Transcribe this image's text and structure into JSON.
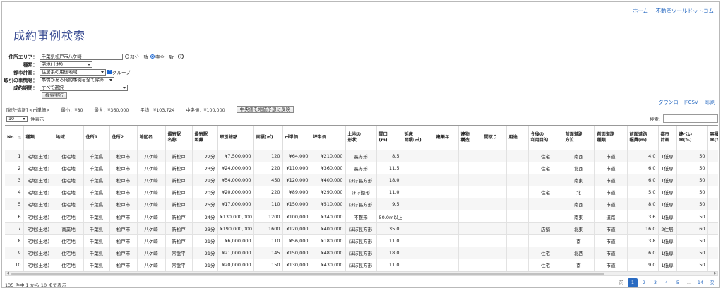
{
  "nav": {
    "home": "ホーム",
    "site": "不動産ツールドットコム"
  },
  "page_title": "成約事例検索",
  "form": {
    "area": {
      "label": "住所エリア：",
      "value": "千葉県松戸市八ケ崎",
      "opt_partial": "部分一致",
      "opt_exact": "完全一致"
    },
    "kind": {
      "label": "種類：",
      "value": "宅地(土地)"
    },
    "city_plan": {
      "label": "都市計画：",
      "value": "住居系の用途地域",
      "group": "グループ"
    },
    "circumstance": {
      "label": "取引の事情等：",
      "value": "事情がある成約事例を全て除外"
    },
    "period": {
      "label": "成約期間：",
      "value": "すべて選択"
    },
    "submit": "検索実行"
  },
  "stats": {
    "label": "[統計情報] <㎡単価>",
    "min": "最小：¥80",
    "max": "最大：¥360,000",
    "avg": "平均：¥103,724",
    "median": "中央値：¥100,000",
    "reflect_button": "中央値を地価予想に反映"
  },
  "links": {
    "csv": "ダウンロードCSV",
    "print": "印刷"
  },
  "length": {
    "value": "10",
    "suffix": "件表示"
  },
  "search_label": "検索:",
  "columns": [
    "No",
    "種類",
    "地域",
    "住所1",
    "住所2",
    "地区名",
    "最寄駅\n名称",
    "最寄駅\n距離",
    "取引総額",
    "面積(㎡)",
    "㎡単価",
    "坪単価",
    "土地の\n形状",
    "間口\n(m)",
    "延床\n面積(㎡)",
    "建築年",
    "建物\n構造",
    "間取り",
    "用途",
    "今後の\n利用目的",
    "前面道路\n方位",
    "前面道路\n種類",
    "前面道路\n幅員(m)",
    "都市\n計画",
    "建ぺい\n率(%)",
    "容積\n率(%)"
  ],
  "rows": [
    [
      "1",
      "宅地(土地)",
      "住宅地",
      "千葉県",
      "松戸市",
      "八ケ崎",
      "新松戸",
      "22分",
      "¥7,500,000",
      "120",
      "¥64,000",
      "¥210,000",
      "長方形",
      "8.5",
      "",
      "",
      "",
      "",
      "",
      "住宅",
      "南西",
      "市道",
      "4.0",
      "1低専",
      "50",
      ""
    ],
    [
      "2",
      "宅地(土地)",
      "住宅地",
      "千葉県",
      "松戸市",
      "八ケ崎",
      "新松戸",
      "23分",
      "¥24,000,000",
      "220",
      "¥110,000",
      "¥360,000",
      "長方形",
      "11.5",
      "",
      "",
      "",
      "",
      "",
      "住宅",
      "北西",
      "市道",
      "6.0",
      "1低専",
      "50",
      ""
    ],
    [
      "3",
      "宅地(土地)",
      "住宅地",
      "千葉県",
      "松戸市",
      "八ケ崎",
      "新松戸",
      "29分",
      "¥54,000,000",
      "450",
      "¥120,000",
      "¥400,000",
      "ほぼ長方形",
      "18.0",
      "",
      "",
      "",
      "",
      "",
      "",
      "南東",
      "市道",
      "6.0",
      "1低専",
      "50",
      ""
    ],
    [
      "4",
      "宅地(土地)",
      "住宅地",
      "千葉県",
      "松戸市",
      "八ケ崎",
      "新松戸",
      "20分",
      "¥20,000,000",
      "220",
      "¥89,000",
      "¥290,000",
      "ほぼ整形",
      "11.0",
      "",
      "",
      "",
      "",
      "",
      "住宅",
      "北",
      "市道",
      "5.0",
      "1低専",
      "50",
      ""
    ],
    [
      "5",
      "宅地(土地)",
      "住宅地",
      "千葉県",
      "松戸市",
      "八ケ崎",
      "新松戸",
      "25分",
      "¥17,000,000",
      "110",
      "¥150,000",
      "¥510,000",
      "ほぼ長方形",
      "9.5",
      "",
      "",
      "",
      "",
      "",
      "",
      "南西",
      "市道",
      "8.0",
      "1低専",
      "50",
      ""
    ],
    [
      "6",
      "宅地(土地)",
      "住宅地",
      "千葉県",
      "松戸市",
      "八ケ崎",
      "新松戸",
      "24分",
      "¥130,000,000",
      "1200",
      "¥100,000",
      "¥340,000",
      "不整形",
      "50.0m以上",
      "",
      "",
      "",
      "",
      "",
      "",
      "南東",
      "道路",
      "3.6",
      "1低専",
      "50",
      ""
    ],
    [
      "7",
      "宅地(土地)",
      "商業地",
      "千葉県",
      "松戸市",
      "八ケ崎",
      "新松戸",
      "23分",
      "¥190,000,000",
      "1600",
      "¥120,000",
      "¥400,000",
      "ほぼ長方形",
      "35.0",
      "",
      "",
      "",
      "",
      "",
      "店舗",
      "北東",
      "市道",
      "16.0",
      "2住居",
      "60",
      ""
    ],
    [
      "8",
      "宅地(土地)",
      "住宅地",
      "千葉県",
      "松戸市",
      "八ケ崎",
      "新松戸",
      "21分",
      "¥6,000,000",
      "110",
      "¥56,000",
      "¥180,000",
      "ほぼ長方形",
      "11.0",
      "",
      "",
      "",
      "",
      "",
      "",
      "南",
      "市道",
      "3.8",
      "1低専",
      "50",
      ""
    ],
    [
      "9",
      "宅地(土地)",
      "住宅地",
      "千葉県",
      "松戸市",
      "八ケ崎",
      "常盤平",
      "21分",
      "¥21,000,000",
      "145",
      "¥150,000",
      "¥480,000",
      "ほぼ長方形",
      "18.0",
      "",
      "",
      "",
      "",
      "",
      "住宅",
      "北西",
      "市道",
      "6.0",
      "1低専",
      "50",
      ""
    ],
    [
      "10",
      "宅地(土地)",
      "住宅地",
      "千葉県",
      "松戸市",
      "八ケ崎",
      "常盤平",
      "21分",
      "¥20,000,000",
      "150",
      "¥130,000",
      "¥430,000",
      "ほぼ長方形",
      "11.0",
      "",
      "",
      "",
      "",
      "",
      "住宅",
      "南",
      "市道",
      "9.0",
      "1低専",
      "50",
      ""
    ]
  ],
  "info": "135 件中 1 から 10 まで表示",
  "pager": {
    "prev": "前",
    "pages": [
      "1",
      "2",
      "3",
      "4",
      "5",
      "...",
      "14"
    ],
    "next": "次",
    "active": "1"
  }
}
